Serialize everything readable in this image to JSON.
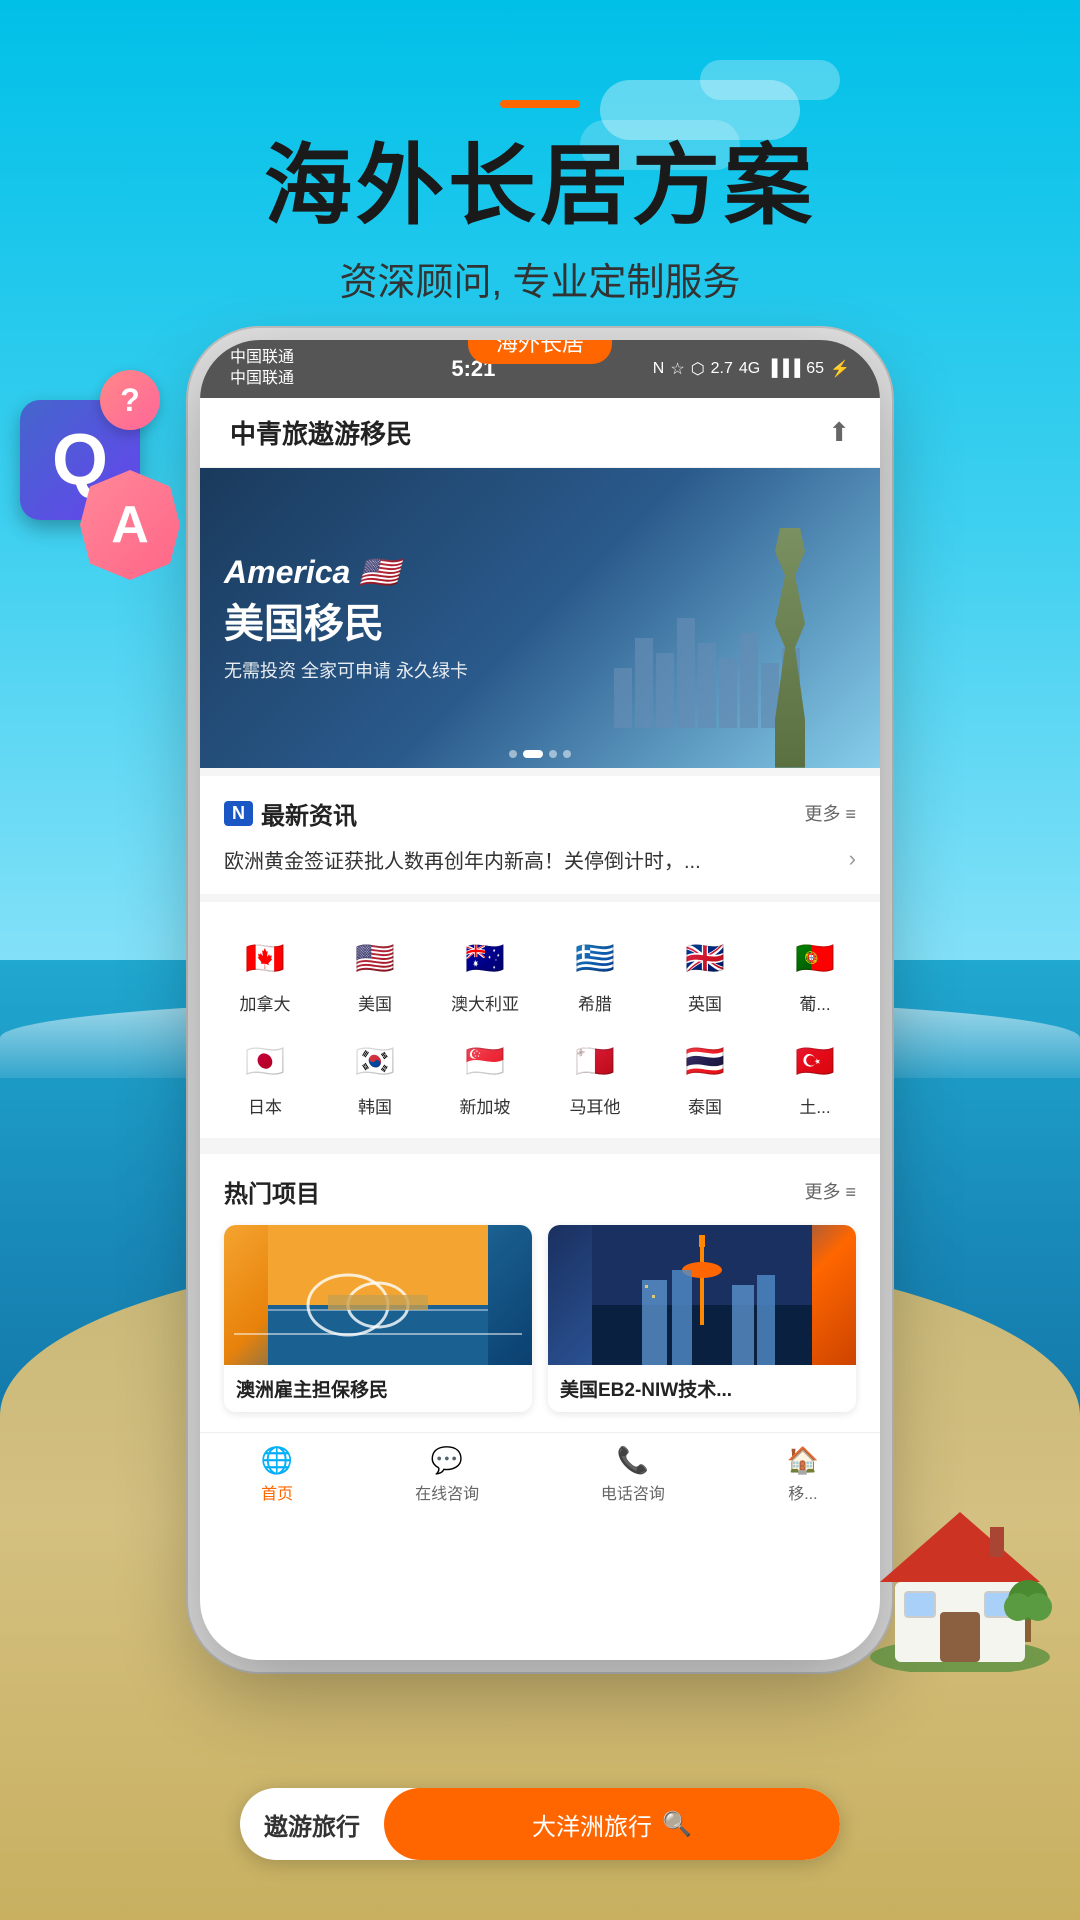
{
  "background": {
    "colors": {
      "sky_top": "#00c0e8",
      "sky_bottom": "#80e8f8",
      "ocean": "#1888b8",
      "sand": "#c8b060"
    }
  },
  "header": {
    "accent_line": "─",
    "title": "海外长居方案",
    "subtitle": "资深顾问, 专业定制服务"
  },
  "phone_tag": "海外长居",
  "status_bar": {
    "carrier1": "中国联通",
    "carrier2": "中国联通",
    "time": "5:21",
    "icons": "N ☆ ♦ 27 M/s 46 4G ⬛ 65"
  },
  "app_header": {
    "title": "中青旅遨游移民",
    "share_icon": "⬆"
  },
  "banner": {
    "main_text": "America 🇺🇸",
    "cn_text": "美国移民",
    "sub_text": "无需投资 全家可申请 永久绿卡",
    "dots": [
      1,
      2,
      3,
      4
    ]
  },
  "news": {
    "badge": "N",
    "title": "最新资讯",
    "more": "更多 ≡",
    "item": "欧洲黄金签证获批人数再创年内新高！关停倒计时，..."
  },
  "countries": [
    {
      "name": "加拿大",
      "flag": "🇨🇦"
    },
    {
      "name": "美国",
      "flag": "🇺🇸"
    },
    {
      "name": "澳大利亚",
      "flag": "🇦🇺"
    },
    {
      "name": "希腊",
      "flag": "🇬🇷"
    },
    {
      "name": "英国",
      "flag": "🇬🇧"
    },
    {
      "name": "葡...",
      "flag": "🇵🇹"
    },
    {
      "name": "日本",
      "flag": "🇯🇵"
    },
    {
      "name": "韩国",
      "flag": "🇰🇷"
    },
    {
      "name": "新加坡",
      "flag": "🇸🇬"
    },
    {
      "name": "马耳他",
      "flag": "🇲🇹"
    },
    {
      "name": "泰国",
      "flag": "🇹🇭"
    },
    {
      "name": "土...",
      "flag": "🇹🇷"
    }
  ],
  "hot_projects": {
    "title": "热门项目",
    "more": "更多 ≡",
    "cards": [
      {
        "label": "澳洲雇主担保移民"
      },
      {
        "label": "美国EB2-NIW技术..."
      }
    ]
  },
  "bottom_nav": [
    {
      "icon": "🌐",
      "label": "首页",
      "active": true
    },
    {
      "icon": "💬",
      "label": "在线咨询",
      "active": false
    },
    {
      "icon": "📞",
      "label": "电话咨询",
      "active": false
    },
    {
      "icon": "🏠",
      "label": "移...",
      "active": false
    }
  ],
  "bottom_bar": {
    "brand": "遨游旅行",
    "search_text": "大洋洲旅行",
    "search_icon": "🔍"
  },
  "qa": {
    "q_label": "Q",
    "a_label": "A",
    "question_mark": "?"
  }
}
